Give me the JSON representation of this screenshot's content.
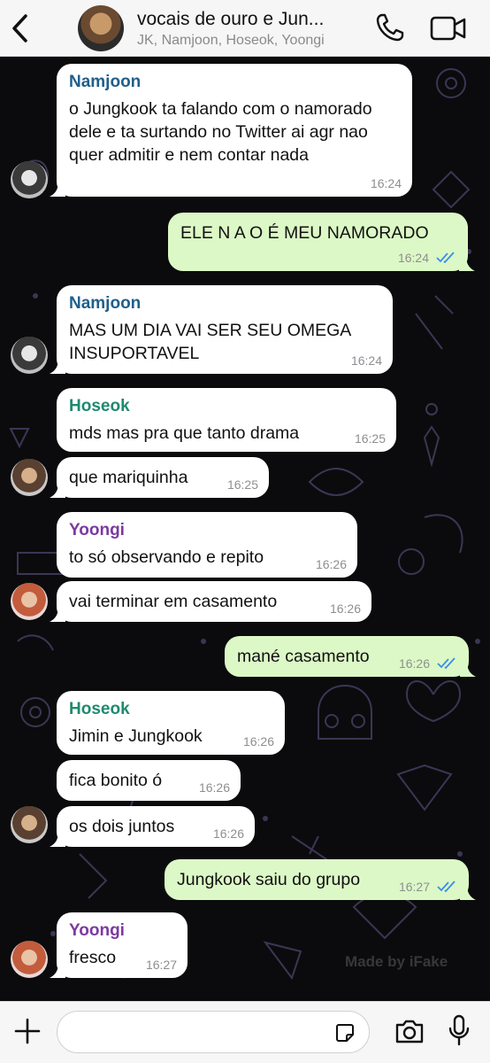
{
  "header": {
    "title": "vocais de ouro e Jun...",
    "subtitle": "JK, Namjoon, Hoseok, Yoongi"
  },
  "messages": [
    {
      "sender": "Namjoon",
      "text": "o Jungkook ta falando com o namorado dele e ta surtando no Twitter ai agr nao quer admitir e nem contar nada",
      "time": "16:24"
    },
    {
      "text": "ELE N A O É MEU NAMORADO",
      "time": "16:24"
    },
    {
      "sender": "Namjoon",
      "text": "MAS UM DIA VAI SER SEU OMEGA INSUPORTAVEL",
      "time": "16:24"
    },
    {
      "sender": "Hoseok",
      "text": "mds mas pra que tanto drama",
      "time": "16:25"
    },
    {
      "text": "que mariquinha",
      "time": "16:25"
    },
    {
      "sender": "Yoongi",
      "text": "to só observando e repito",
      "time": "16:26"
    },
    {
      "text": "vai terminar em casamento",
      "time": "16:26"
    },
    {
      "text": "mané casamento",
      "time": "16:26"
    },
    {
      "sender": "Hoseok",
      "text": "Jimin e Jungkook",
      "time": "16:26"
    },
    {
      "text": "fica bonito ó",
      "time": "16:26"
    },
    {
      "text": "os dois juntos",
      "time": "16:26"
    },
    {
      "text": "Jungkook saiu do grupo",
      "time": "16:27"
    },
    {
      "sender": "Yoongi",
      "text": "fresco",
      "time": "16:27"
    }
  ],
  "colors": {
    "namjoon": "#1f5f8b",
    "hoseok": "#1f8a6e",
    "yoongi": "#7b3aa0",
    "outgoing_bubble": "#dcf8c6",
    "read_ticks": "#3a8ee6"
  },
  "watermark": "Made by iFake",
  "icons": {
    "back": "chevron-left-icon",
    "call": "phone-icon",
    "video": "video-camera-icon",
    "plus": "plus-icon",
    "sticker": "sticker-icon",
    "camera": "camera-icon",
    "mic": "microphone-icon"
  }
}
